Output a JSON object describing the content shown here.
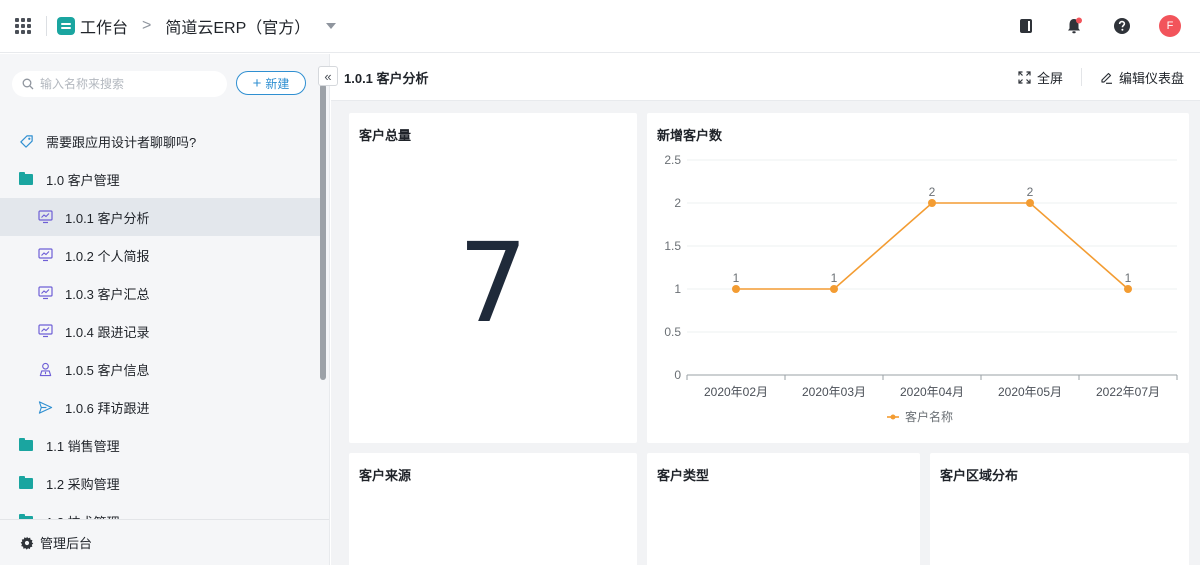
{
  "topbar": {
    "workbench_label": "工作台",
    "breadcrumb_sep": ">",
    "app_name": "简道云ERP（官方）",
    "avatar_letter": "F",
    "accent": "#1aa5a0"
  },
  "sidebar": {
    "search_placeholder": "输入名称来搜索",
    "new_button": "新建",
    "collapse_glyph": "«",
    "items": [
      {
        "label": "需要跟应用设计者聊聊吗?",
        "icon": "tag-icon"
      },
      {
        "label": "1.0 客户管理",
        "icon": "folder-icon"
      },
      {
        "label": "1.0.1 客户分析",
        "icon": "dashboard-icon",
        "active": true
      },
      {
        "label": "1.0.2 个人简报",
        "icon": "dashboard-icon"
      },
      {
        "label": "1.0.3 客户汇总",
        "icon": "dashboard-icon"
      },
      {
        "label": "1.0.4 跟进记录",
        "icon": "dashboard-icon"
      },
      {
        "label": "1.0.5 客户信息",
        "icon": "person-icon"
      },
      {
        "label": "1.0.6 拜访跟进",
        "icon": "send-icon"
      },
      {
        "label": "1.1 销售管理",
        "icon": "folder-icon"
      },
      {
        "label": "1.2 采购管理",
        "icon": "folder-icon"
      },
      {
        "label": "1.3 技术管理",
        "icon": "folder-icon"
      }
    ],
    "footer_label": "管理后台"
  },
  "main": {
    "title": "1.0.1 客户分析",
    "fullscreen": "全屏",
    "edit_dashboard": "编辑仪表盘",
    "cards": {
      "total": {
        "title": "客户总量",
        "value": "7"
      },
      "new": {
        "title": "新增客户数"
      },
      "source": {
        "title": "客户来源"
      },
      "type": {
        "title": "客户类型"
      },
      "region": {
        "title": "客户区域分布"
      }
    }
  },
  "chart_data": {
    "type": "line",
    "title": "新增客户数",
    "categories": [
      "2020年02月",
      "2020年03月",
      "2020年04月",
      "2020年05月",
      "2022年07月"
    ],
    "series": [
      {
        "name": "客户名称",
        "values": [
          1,
          1,
          2,
          2,
          1
        ]
      }
    ],
    "data_labels": [
      "1",
      "1",
      "2",
      "2",
      "1"
    ],
    "yticks": [
      "0",
      "0.5",
      "1",
      "1.5",
      "2",
      "2.5"
    ],
    "ylim": [
      0,
      2.5
    ],
    "grid": true,
    "legend": "bottom",
    "color": "#f39c32"
  }
}
